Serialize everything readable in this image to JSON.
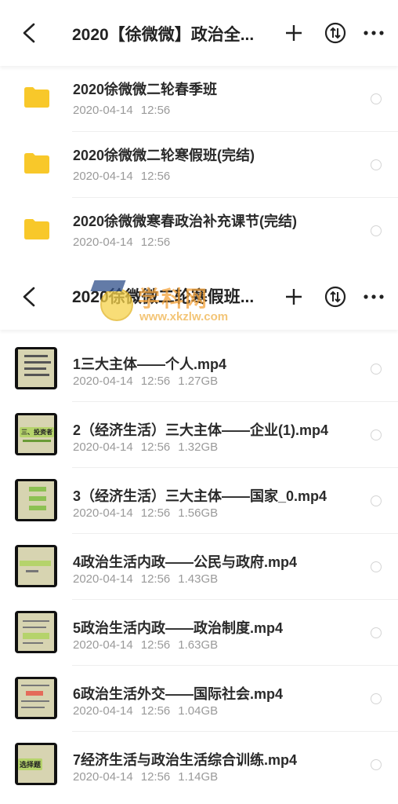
{
  "header_top": {
    "title": "2020【徐微微】政治全...",
    "icons": {
      "back": "back-chevron-icon",
      "add": "plus-icon",
      "sort": "sort-updown-icon",
      "more": "more-dots-icon"
    }
  },
  "folders": [
    {
      "name": "2020徐微微二轮春季班",
      "date": "2020-04-14",
      "time": "12:56"
    },
    {
      "name": "2020徐微微二轮寒假班(完结)",
      "date": "2020-04-14",
      "time": "12:56"
    },
    {
      "name": "2020徐微微寒春政治补充课节(完结)",
      "date": "2020-04-14",
      "time": "12:56"
    }
  ],
  "header_bottom": {
    "title": "2020徐微微二轮寒假班..."
  },
  "watermark": {
    "title": "学科网",
    "url": "www.xkzlw.com"
  },
  "files": [
    {
      "name": "1三大主体——个人.mp4",
      "date": "2020-04-14",
      "time": "12:56",
      "size": "1.27GB",
      "thumb_tag": ""
    },
    {
      "name": "2（经济生活）三大主体——企业(1).mp4",
      "date": "2020-04-14",
      "time": "12:56",
      "size": "1.32GB",
      "thumb_tag": "三、投资者"
    },
    {
      "name": "3（经济生活）三大主体——国家_0.mp4",
      "date": "2020-04-14",
      "time": "12:56",
      "size": "1.56GB",
      "thumb_tag": ""
    },
    {
      "name": "4政治生活内政——公民与政府.mp4",
      "date": "2020-04-14",
      "time": "12:56",
      "size": "1.43GB",
      "thumb_tag": ""
    },
    {
      "name": "5政治生活内政——政治制度.mp4",
      "date": "2020-04-14",
      "time": "12:56",
      "size": "1.63GB",
      "thumb_tag": ""
    },
    {
      "name": "6政治生活外交——国际社会.mp4",
      "date": "2020-04-14",
      "time": "12:56",
      "size": "1.04GB",
      "thumb_tag": ""
    },
    {
      "name": "7经济生活与政治生活综合训练.mp4",
      "date": "2020-04-14",
      "time": "12:56",
      "size": "1.14GB",
      "thumb_tag": "选择题"
    }
  ],
  "colors": {
    "folder": "#f8c82a",
    "meta": "#9a9a9a",
    "divider": "#eeeeee"
  }
}
